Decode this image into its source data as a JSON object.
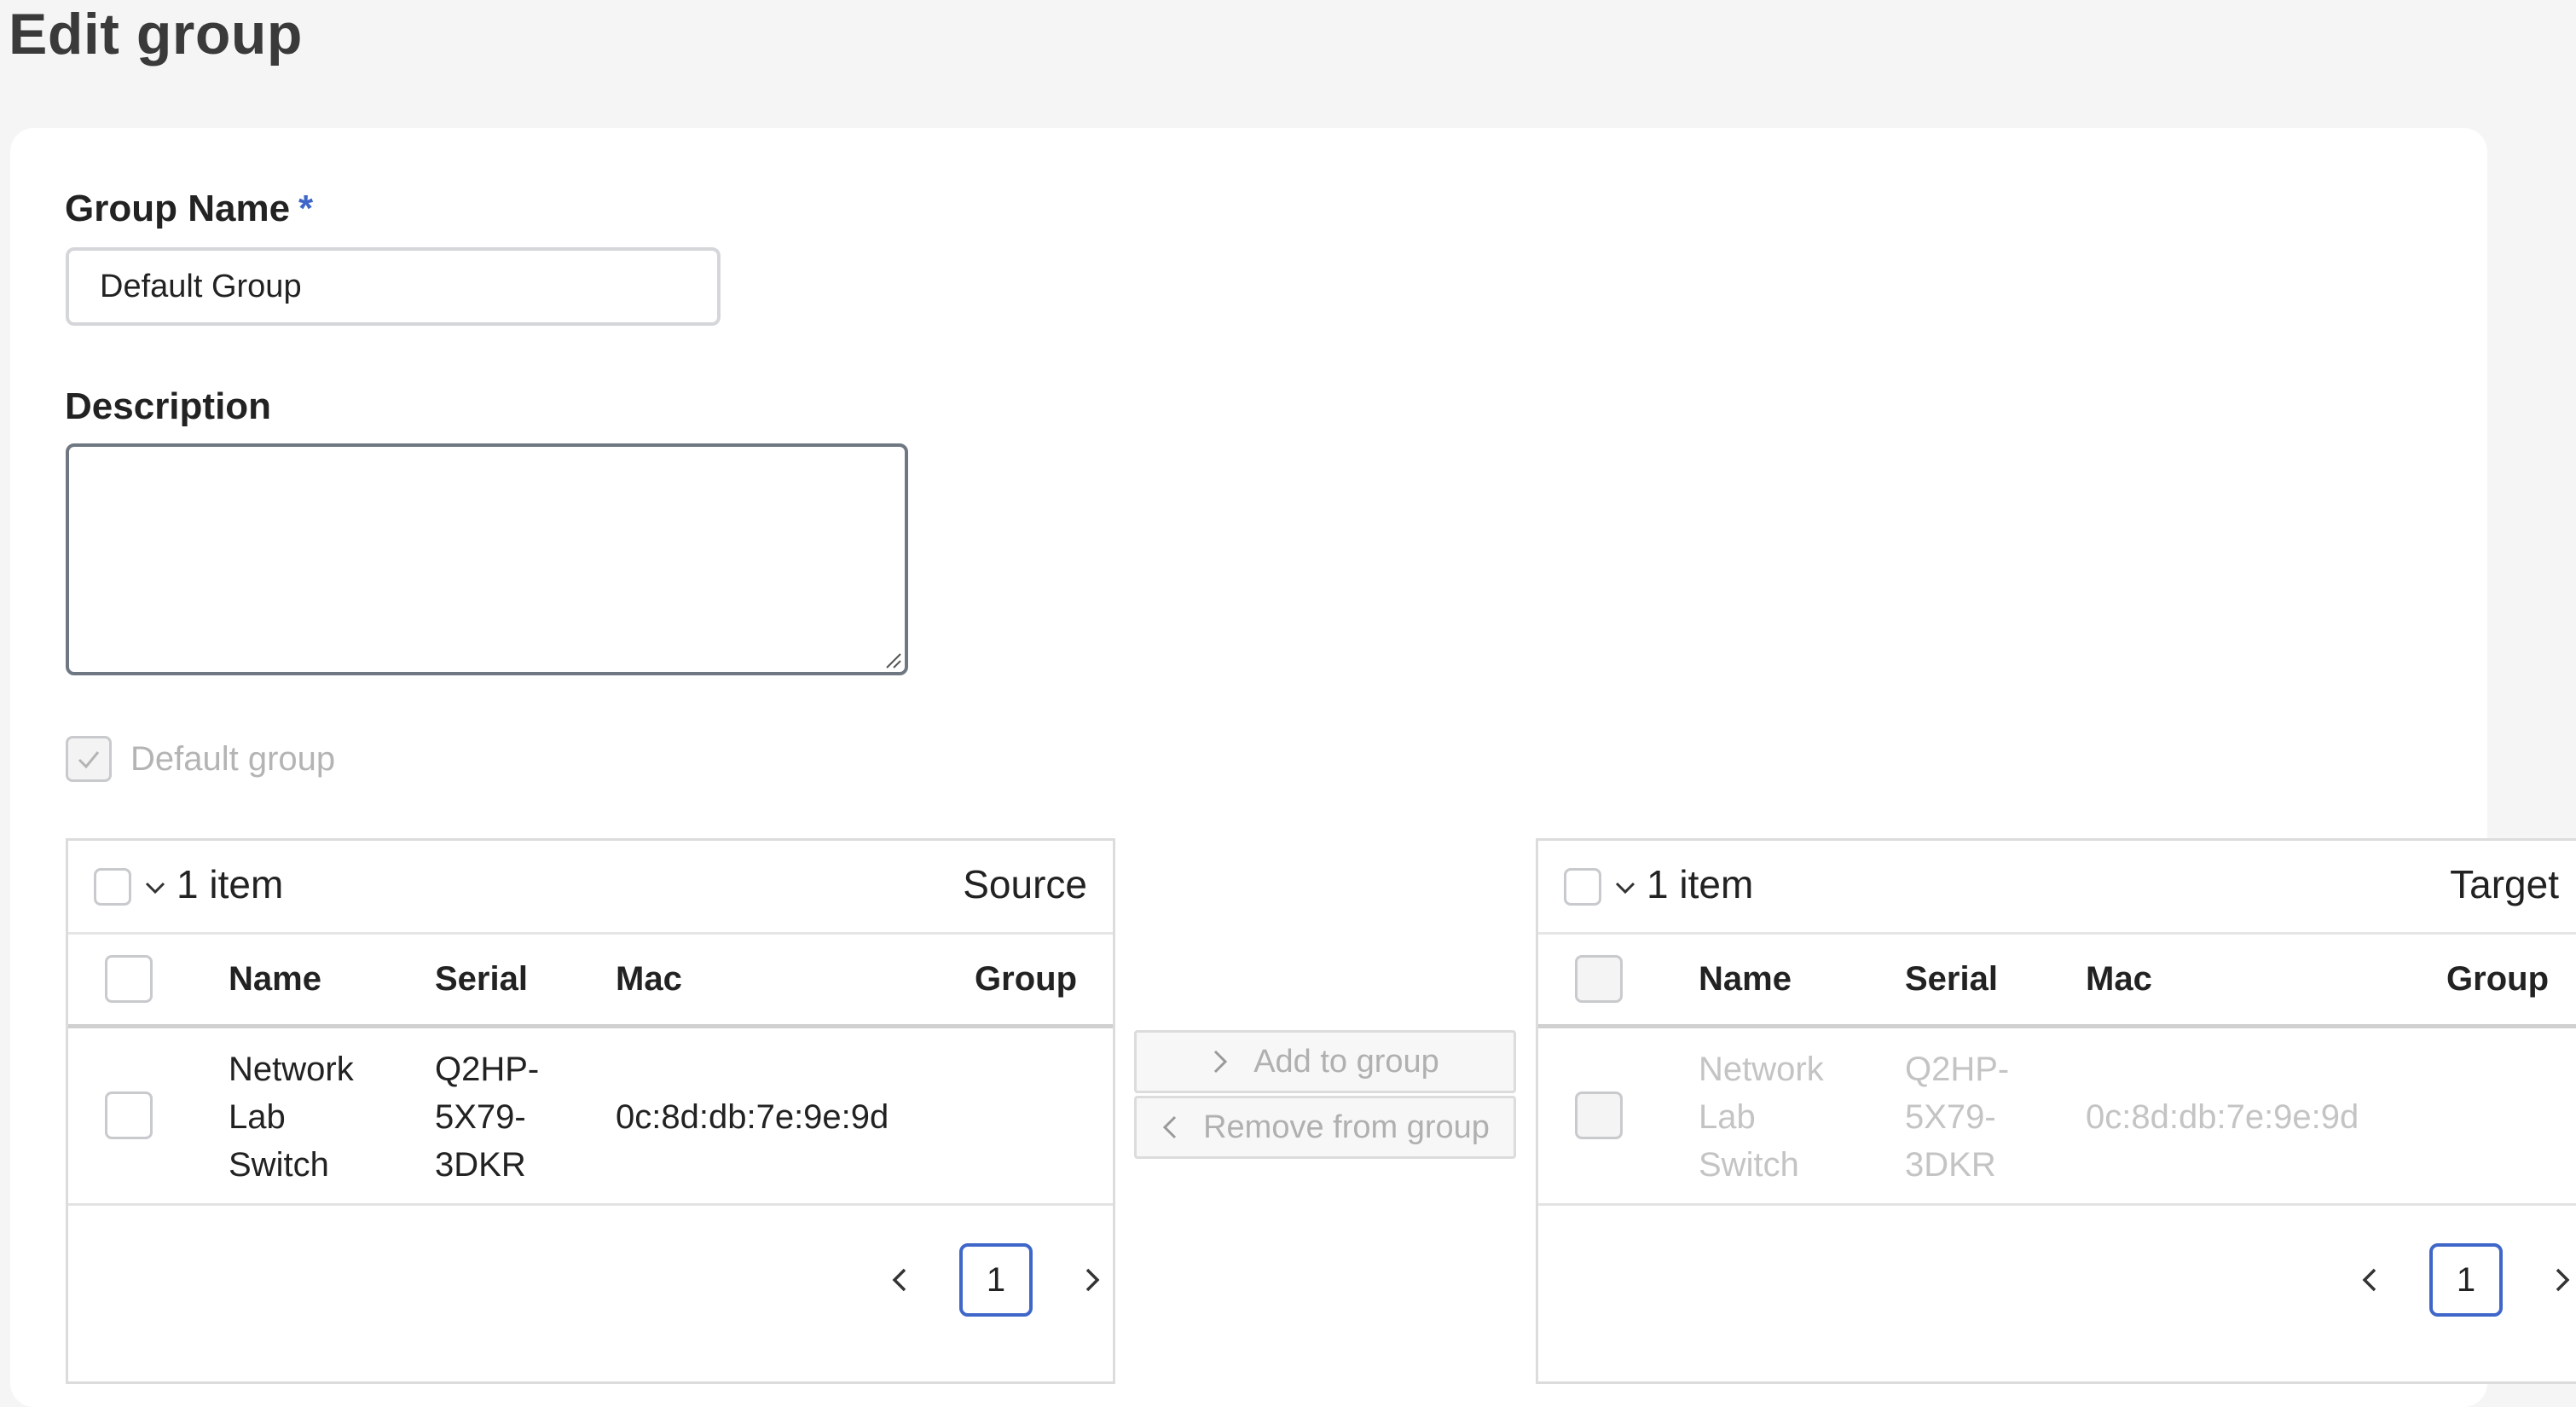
{
  "page": {
    "title": "Edit group"
  },
  "form": {
    "group_name_label": "Group Name",
    "required_mark": "*",
    "group_name_value": "Default Group",
    "description_label": "Description",
    "description_value": "",
    "default_group_label": "Default group",
    "default_group_checked": true
  },
  "source": {
    "count": "1 item",
    "title": "Source",
    "columns": [
      "Name",
      "Serial",
      "Mac",
      "Group"
    ],
    "rows": [
      {
        "name": [
          "Network",
          "Lab",
          "Switch"
        ],
        "serial": [
          "Q2HP-",
          "5X79-",
          "3DKR"
        ],
        "mac": "0c:8d:db:7e:9e:9d",
        "group": ""
      }
    ],
    "page": "1"
  },
  "operations": {
    "add_label": "Add to group",
    "remove_label": "Remove from group"
  },
  "target": {
    "count": "1 item",
    "title": "Target",
    "columns": [
      "Name",
      "Serial",
      "Mac",
      "Group"
    ],
    "rows": [
      {
        "name": [
          "Network",
          "Lab",
          "Switch"
        ],
        "serial": [
          "Q2HP-",
          "5X79-",
          "3DKR"
        ],
        "mac": "0c:8d:db:7e:9e:9d",
        "group": ""
      }
    ],
    "page": "1"
  },
  "colors": {
    "accent": "#3f67c9",
    "disabled_text": "#c4c4c4"
  },
  "icons": [
    "chevron-down-icon",
    "chevron-right-icon",
    "chevron-left-icon",
    "check-icon"
  ]
}
